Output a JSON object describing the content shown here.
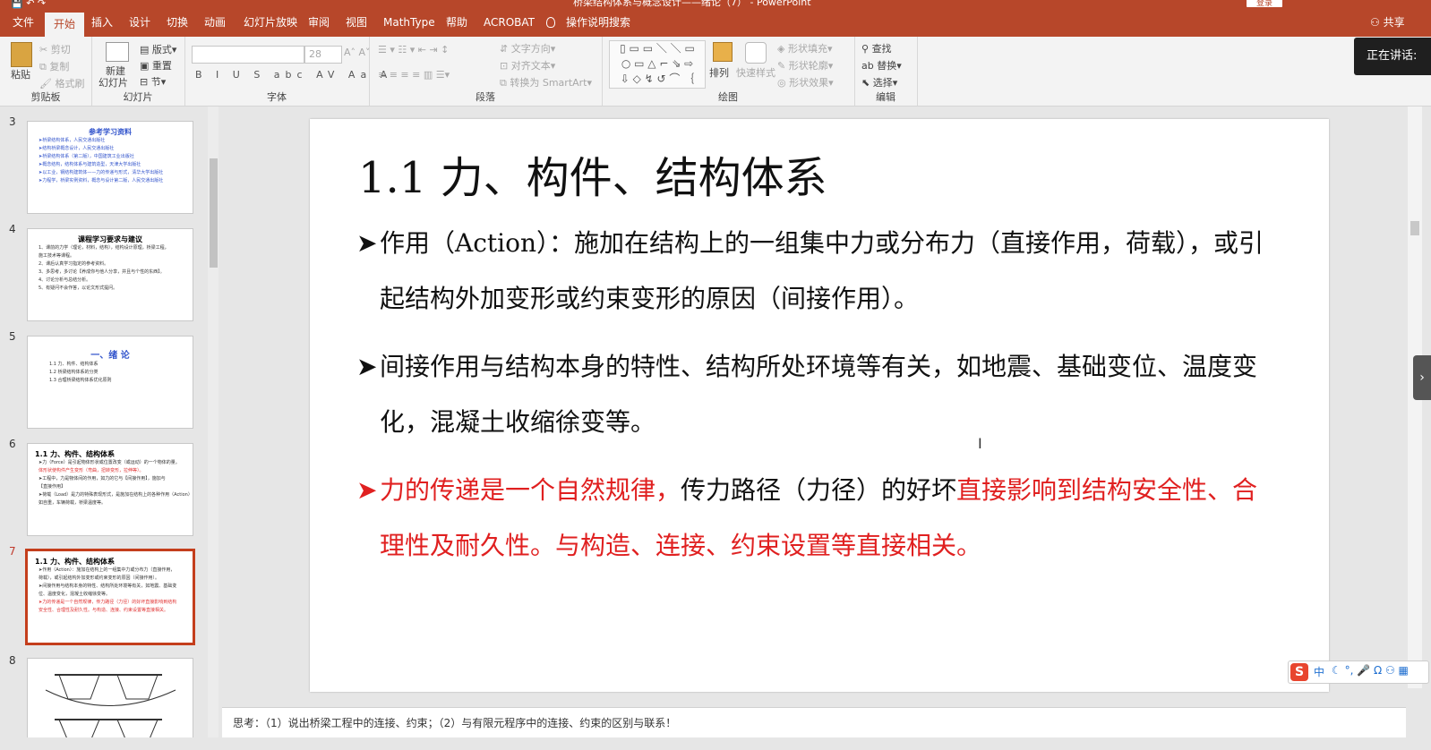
{
  "app": {
    "doc_title": "桥梁结构体系与概念设计——绪论（7） - PowerPoint",
    "login": "登录",
    "share": "共享",
    "speaking": "正在讲话: "
  },
  "tabs": [
    "文件",
    "开始",
    "插入",
    "设计",
    "切换",
    "动画",
    "幻灯片放映",
    "审阅",
    "视图",
    "MathType",
    "帮助",
    "ACROBAT",
    "操作说明搜索"
  ],
  "active_tab": "开始",
  "ribbon": {
    "clipboard": {
      "label": "剪贴板",
      "paste": "粘贴",
      "cut": "剪切",
      "copy": "复制",
      "format_painter": "格式刷"
    },
    "slides": {
      "label": "幻灯片",
      "new_slide": "新建",
      "new_slide2": "幻灯片",
      "layout": "版式",
      "reset": "重置",
      "section": "节"
    },
    "font": {
      "label": "字体",
      "size": "28"
    },
    "paragraph": {
      "label": "段落",
      "text_direction": "文字方向",
      "align_text": "对齐文本",
      "smartart": "转换为 SmartArt"
    },
    "drawing": {
      "label": "绘图",
      "arrange": "排列",
      "quick_styles": "快速样式",
      "shape_fill": "形状填充",
      "shape_outline": "形状轮廓",
      "shape_effects": "形状效果"
    },
    "editing": {
      "label": "编辑",
      "find": "查找",
      "replace": "替换",
      "select": "选择"
    }
  },
  "thumbnails": [
    {
      "num": "3",
      "title": "参考学习资料",
      "lines": [
        "➤桥梁结构体系，人民交通出版社",
        "➤结构桥梁概念设计，人民交通出版社",
        "➤桥梁结构体系（第二版），中国建筑工业出版社",
        "➤概念结构，结构体系与建筑造型，天津大学出版社",
        "➤以工业，钢结构建筑体——力的传递与形式，清华大学出版社",
        "➤力程学，桥梁实例资料，概念与设计第二版，人民交通出版社"
      ]
    },
    {
      "num": "4",
      "title": "课程学习要求与建议",
      "lines": [
        "1、课前的力学（理论，材料，结构），结构设计原理，桥梁工程，",
        "施工技术等课程。",
        "2、课后认真学习指定的参考资料。",
        "3、多思考，多讨论【养成你与他人分享，并且与个性的东西】。",
        "4、讨论分析与总结分析。",
        "5、有疑问不会作答，以论文形式提问。"
      ]
    },
    {
      "num": "5",
      "title": "一、绪 论",
      "lines": [
        "1.1 力、构件、结构体系",
        "1.2 桥梁结构体系的分类",
        "1.3 合理桥梁结构体系优化原则"
      ]
    },
    {
      "num": "6",
      "title": "1.1 力、构件、结构体系",
      "lines": [
        "➤力（Force）是引起物体形状或位置改变（或运动）的一个物体的量。",
        "体形状使构件产生变形（弯曲，扭转变形，拉伸等）。",
        "➤工程中，力是物体间的作用，如力的它与【间接作用】，施加与",
        "【直接作用】",
        "➤荷载（Load）是力的特殊表现形式，是施加在结构上的各种作用（Action）",
        "如自重，车辆荷载，桥梁温度等。"
      ]
    },
    {
      "num": "7",
      "title": "1.1 力、构件、结构体系",
      "lines": [
        "➤作用（Action）：施加在结构上的一组集中力或分布力（直接作用，",
        "荷载），或引起结构外加变形或约束变形的原因（间接作用）。",
        "➤间接作用与结构本身的特性、结构所处环境等有关，如地震、基础变",
        "位、温度变化，混凝土收缩徐变等。",
        "➤力的传递是一个自然规律，传力路径（力径）的好坏直接影响到结构",
        "安全性、合理性及耐久性。与构造、连接、约束设置等直接相关。"
      ]
    },
    {
      "num": "8",
      "title": "",
      "lines": []
    }
  ],
  "slide": {
    "title": "1.1 力、构件、结构体系",
    "bullets": [
      {
        "marker": "➤",
        "text": "作用（Action）：施加在结构上的一组集中力或分布力（直接作用，荷载），或引起结构外加变形或约束变形的原因（间接作用）。",
        "color": "#111111"
      },
      {
        "marker": "➤",
        "text": "间接作用与结构本身的特性、结构所处环境等有关，如地震、基础变位、温度变化，混凝土收缩徐变等。",
        "color": "#111111"
      },
      {
        "marker": "➤",
        "text_red1": "力的传递是一个自然规律，",
        "text_black": "传力路径（力径）的好坏",
        "text_red2": "直接影响到结构安全性、合理性及耐久性。与构造、连接、约束设置等直接相关。",
        "color": "#e02020"
      }
    ]
  },
  "notes": "思考：（1）说出桥梁工程中的连接、约束；（2）与有限元程序中的连接、约束的区别与联系！",
  "ime": {
    "logo": "S",
    "mode": "中"
  }
}
